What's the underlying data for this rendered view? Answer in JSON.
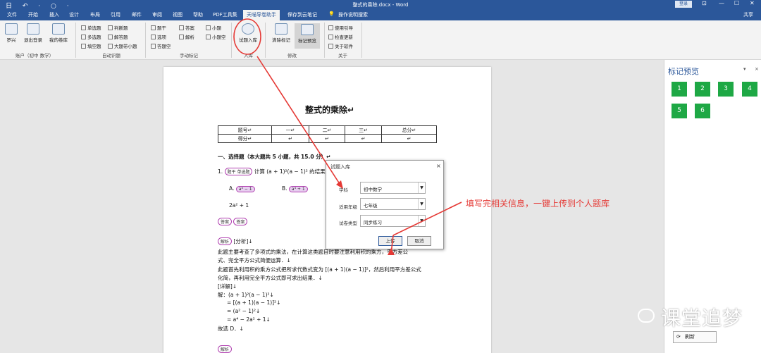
{
  "title": {
    "qat": "日 ↶ · ○ ·",
    "doc": "整式的乘除.docx - Word",
    "login": "登录",
    "ctrl": [
      "⊡",
      "—",
      "☐",
      "✕"
    ]
  },
  "tabs": [
    "文件",
    "开始",
    "插入",
    "设计",
    "布局",
    "引用",
    "邮件",
    "审阅",
    "视图",
    "帮助",
    "PDF工具集",
    "天喵导卷助手",
    "保存到云笔记",
    "操作说明搜索",
    "共享"
  ],
  "ribbon": {
    "account": {
      "items": [
        "罗兴",
        "退出登录",
        "我的卷库"
      ],
      "group": "账户（初中 数学）"
    },
    "auto": {
      "items": [
        "单选题",
        "多选题",
        "填空题",
        "判断题",
        "解答题",
        "大题带小题"
      ],
      "group": "自动识题"
    },
    "manual": {
      "items": [
        "题干",
        "答案",
        "小题",
        "选项",
        "解析",
        "小题空",
        "答题空"
      ],
      "group": "手动标记"
    },
    "ruku": {
      "big": "试题入库",
      "group": "入库"
    },
    "edit": {
      "items": [
        "清除标记",
        "标记预览"
      ],
      "group": "修改"
    },
    "about": {
      "items": [
        "使用引导",
        "检查更新",
        "关于软件"
      ],
      "group": "关于"
    }
  },
  "doc": {
    "title": "整式的乘除↵",
    "table": {
      "header": [
        "题号↵",
        "一↵",
        "二↵",
        "三↵",
        "总分↵"
      ],
      "row": [
        "得分↵",
        "↵",
        "↵",
        "↵",
        "↵"
      ]
    },
    "section": "一、选择题（本大题共 5 小题，共 15.0 分）↵",
    "q1_num": "1.",
    "q1_tag": "题干 单选题",
    "q1_text": "计算 (a + 1)²(a − 1)² 的结果是",
    "optA": "A.",
    "optA_val": "a⁴ − 1",
    "optB": "B.",
    "optB_val": "a⁴ + 1",
    "optC_val": "2a² + 1",
    "answer_tags": [
      "答案",
      "答案"
    ],
    "jiexi_tag": "解析",
    "analysis_head": "[分析]↓",
    "analysis": [
      "此题主要考查了多项式的乘法，在计算这类题目时要注意利用积的乘方，平方差公",
      "式、完全平方公式简便运算．↓",
      "此题首先利用积的乘方公式把所求代数式变为 [(a + 1)(a − 1)]²，然后利用平方差公式",
      "化简，再利用完全平方公式即可求出结果．↓"
    ],
    "detail_head": "[详解]↓",
    "solution": [
      "解：(a + 1)²(a − 1)²↓",
      "= [(a + 1)(a − 1)]²↓",
      "= (a² − 1)²↓",
      "= a⁴ − 2a² + 1↓",
      "故选 D．↓"
    ],
    "bottom_tag": "解析"
  },
  "dialog": {
    "title": "试题入库",
    "close": "×",
    "rows": [
      {
        "label": "学科",
        "value": "初中数学"
      },
      {
        "label": "适用年级",
        "value": "七年级"
      },
      {
        "label": "试卷类型",
        "value": "同步练习"
      }
    ],
    "ok": "上传",
    "cancel": "取消"
  },
  "annotation": "填写完相关信息，一键上传到个人题库",
  "pane": {
    "title": "标记预览",
    "marks": [
      "1",
      "2",
      "3",
      "4",
      "5",
      "6"
    ],
    "refresh": "刷新"
  },
  "watermark": "课堂追梦",
  "colors": {
    "brand": "#2b579a",
    "mark": "#1ea845",
    "annotation": "#e53935"
  }
}
